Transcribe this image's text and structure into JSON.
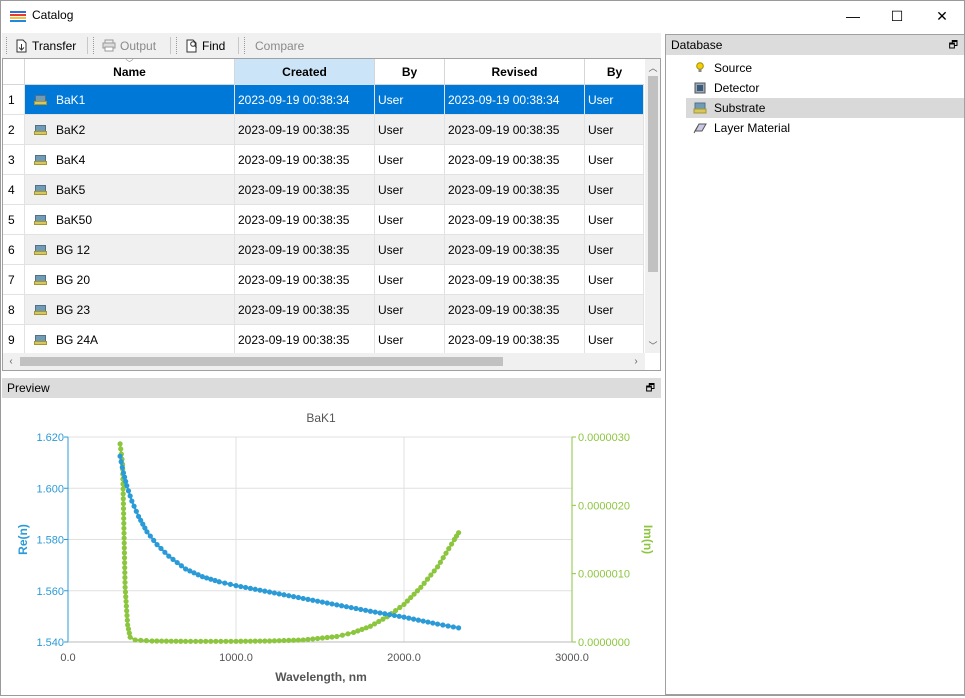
{
  "window": {
    "title": "Catalog",
    "minimize": "—",
    "maximize": "☐",
    "close": "✕"
  },
  "toolbar": {
    "transfer": "Transfer",
    "output": "Output",
    "find": "Find",
    "compare": "Compare"
  },
  "table": {
    "columns": [
      "Name",
      "Created",
      "By",
      "Revised",
      "By"
    ],
    "rows": [
      {
        "num": "1",
        "name": "BaK1",
        "created": "2023-09-19 00:38:34",
        "by": "User",
        "revised": "2023-09-19 00:38:34",
        "by2": "User"
      },
      {
        "num": "2",
        "name": "BaK2",
        "created": "2023-09-19 00:38:35",
        "by": "User",
        "revised": "2023-09-19 00:38:35",
        "by2": "User"
      },
      {
        "num": "3",
        "name": "BaK4",
        "created": "2023-09-19 00:38:35",
        "by": "User",
        "revised": "2023-09-19 00:38:35",
        "by2": "User"
      },
      {
        "num": "4",
        "name": "BaK5",
        "created": "2023-09-19 00:38:35",
        "by": "User",
        "revised": "2023-09-19 00:38:35",
        "by2": "User"
      },
      {
        "num": "5",
        "name": "BaK50",
        "created": "2023-09-19 00:38:35",
        "by": "User",
        "revised": "2023-09-19 00:38:35",
        "by2": "User"
      },
      {
        "num": "6",
        "name": "BG 12",
        "created": "2023-09-19 00:38:35",
        "by": "User",
        "revised": "2023-09-19 00:38:35",
        "by2": "User"
      },
      {
        "num": "7",
        "name": "BG 20",
        "created": "2023-09-19 00:38:35",
        "by": "User",
        "revised": "2023-09-19 00:38:35",
        "by2": "User"
      },
      {
        "num": "8",
        "name": "BG 23",
        "created": "2023-09-19 00:38:35",
        "by": "User",
        "revised": "2023-09-19 00:38:35",
        "by2": "User"
      },
      {
        "num": "9",
        "name": "BG 24A",
        "created": "2023-09-19 00:38:35",
        "by": "User",
        "revised": "2023-09-19 00:38:35",
        "by2": "User"
      }
    ]
  },
  "preview": {
    "header": "Preview"
  },
  "database": {
    "header": "Database",
    "items": [
      "Source",
      "Detector",
      "Substrate",
      "Layer Material"
    ],
    "selected": "Substrate"
  },
  "colors": {
    "accent": "#0078d7",
    "re_series": "#2b9bd8",
    "im_series": "#8cc63f"
  },
  "chart_data": {
    "type": "line",
    "title": "BaK1",
    "xlabel": "Wavelength, nm",
    "ylabel": "Re(n)",
    "y2label": "Im(n)",
    "xlim": [
      0,
      3000
    ],
    "ylim": [
      1.54,
      1.62
    ],
    "y2lim": [
      0,
      3e-06
    ],
    "xticks": [
      "0.0",
      "1000.0",
      "2000.0",
      "3000.0"
    ],
    "yticks": [
      "1.540",
      "1.560",
      "1.580",
      "1.600",
      "1.620"
    ],
    "y2ticks": [
      "0.0000000",
      "0.0000010",
      "0.0000020",
      "0.0000030"
    ],
    "grid": true,
    "series": [
      {
        "name": "Re(n)",
        "axis": "left",
        "x": [
          310,
          330,
          350,
          380,
          420,
          470,
          530,
          600,
          700,
          800,
          900,
          1000,
          1200,
          1400,
          1600,
          1800,
          2000,
          2200,
          2325
        ],
        "y": [
          1.6125,
          1.606,
          1.601,
          1.595,
          1.589,
          1.583,
          1.578,
          1.5735,
          1.5685,
          1.5655,
          1.5635,
          1.562,
          1.5595,
          1.557,
          1.5545,
          1.552,
          1.5497,
          1.547,
          1.5455
        ]
      },
      {
        "name": "Im(n)",
        "axis": "right",
        "x": [
          310,
          325,
          340,
          355,
          370,
          400,
          500,
          700,
          1000,
          1200,
          1400,
          1600,
          1700,
          1800,
          1900,
          2000,
          2100,
          2200,
          2300,
          2325
        ],
        "y": [
          2.9e-06,
          2.6e-06,
          8e-07,
          2.5e-07,
          7e-08,
          3e-08,
          1.5e-08,
          1e-08,
          1e-08,
          1.5e-08,
          3e-08,
          8e-08,
          1.4e-07,
          2.3e-07,
          3.7e-07,
          5.5e-07,
          8e-07,
          1.1e-06,
          1.5e-06,
          1.6e-06
        ]
      }
    ]
  }
}
